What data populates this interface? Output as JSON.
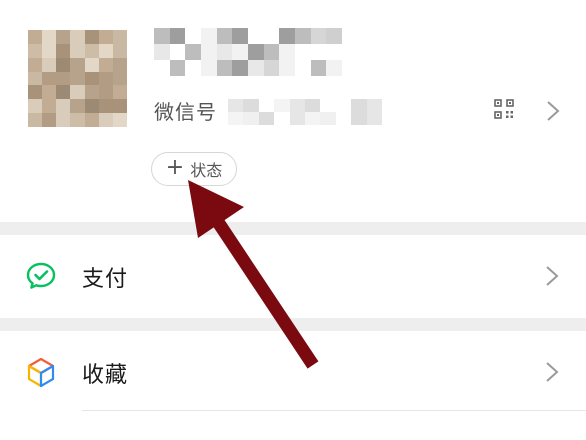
{
  "profile": {
    "wechat_id_label": "微信号",
    "status_plus": "+",
    "status_label": "状态"
  },
  "icons": {
    "qr": "qr-code-icon",
    "chevron": "chevron-right-icon",
    "pay": "wechat-pay-icon",
    "favorites": "favorites-cube-icon"
  },
  "menu": [
    {
      "label": "支付"
    },
    {
      "label": "收藏"
    }
  ],
  "colors": {
    "pay_green": "#07c160",
    "annotation_arrow": "#7a0a0f"
  }
}
